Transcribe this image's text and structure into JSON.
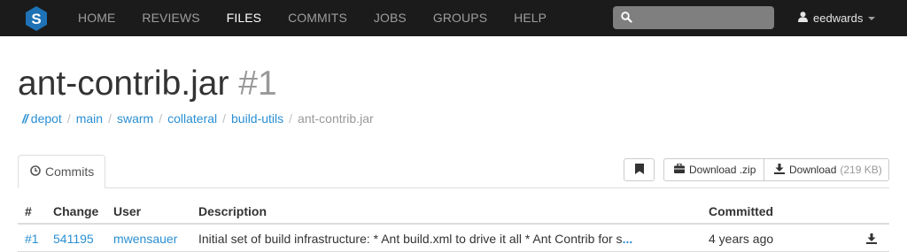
{
  "brand": {
    "logo_letter": "S"
  },
  "nav": {
    "items": [
      "HOME",
      "REVIEWS",
      "FILES",
      "COMMITS",
      "JOBS",
      "GROUPS",
      "HELP"
    ],
    "active": "FILES"
  },
  "search": {
    "placeholder": "",
    "value": ""
  },
  "user": {
    "name": "eedwards"
  },
  "page": {
    "title": "ant-contrib.jar",
    "revision": "#1"
  },
  "breadcrumb": {
    "root": "//",
    "items": [
      "depot",
      "main",
      "swarm",
      "collateral",
      "build-utils"
    ],
    "current": "ant-contrib.jar",
    "separator": "/"
  },
  "tabs": {
    "commits": "Commits"
  },
  "buttons": {
    "download_zip": "Download .zip",
    "download": "Download",
    "download_size": "(219 KB)"
  },
  "table": {
    "headers": {
      "rev": "#",
      "change": "Change",
      "user": "User",
      "description": "Description",
      "committed": "Committed"
    },
    "rows": [
      {
        "rev": "#1",
        "change": "541195",
        "user": "mwensauer",
        "description": "Initial set of build infrastructure: * Ant build.xml to drive it all * Ant Contrib for s",
        "more": "...",
        "committed": "4 years ago"
      }
    ]
  },
  "colors": {
    "navbar_bg": "#1b1b1b",
    "link": "#2a8fd3",
    "logo_blue": "#1e72b5"
  }
}
